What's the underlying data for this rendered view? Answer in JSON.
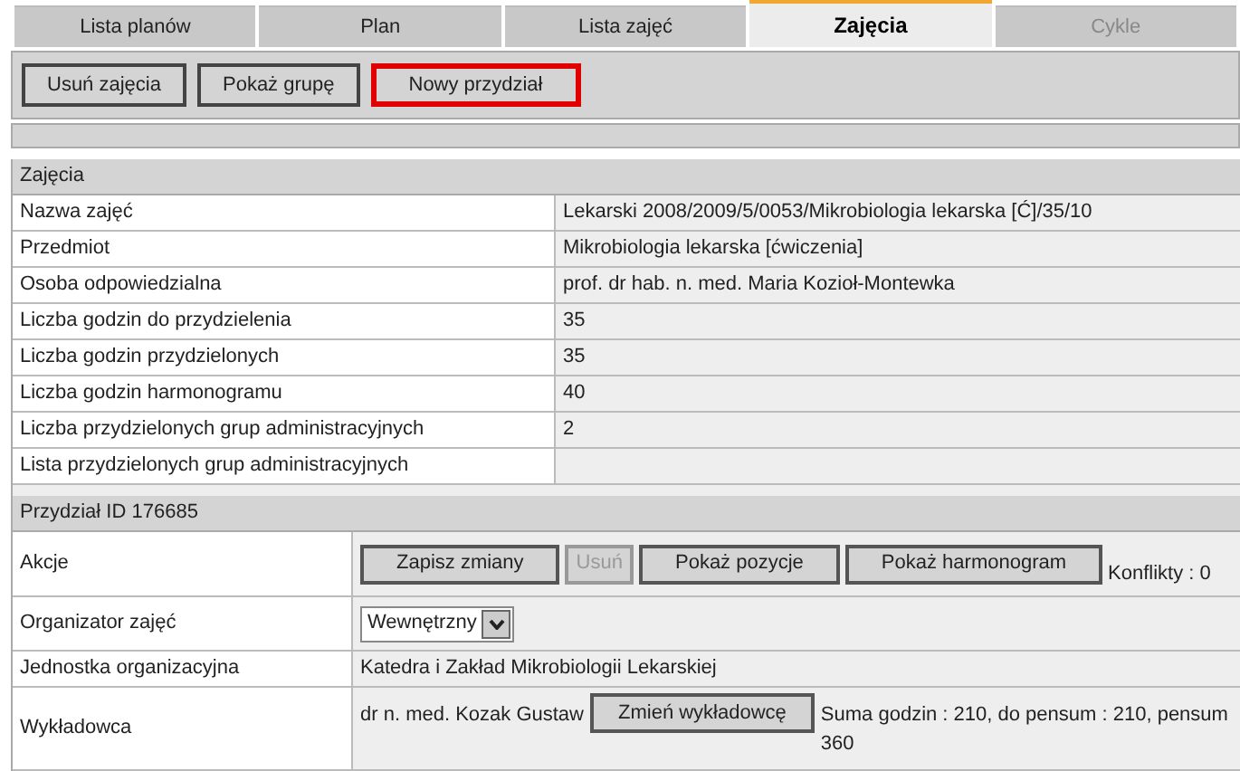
{
  "tabs": [
    {
      "label": "Lista planów",
      "selected": false,
      "disabled": false
    },
    {
      "label": "Plan",
      "selected": false,
      "disabled": false
    },
    {
      "label": "Lista zajęć",
      "selected": false,
      "disabled": false
    },
    {
      "label": "Zajęcia",
      "selected": true,
      "disabled": false
    },
    {
      "label": "Cykle",
      "selected": false,
      "disabled": true
    }
  ],
  "toolbar": [
    {
      "label": "Usuń zajęcia",
      "highlighted": false
    },
    {
      "label": "Pokaż grupę",
      "highlighted": false
    },
    {
      "label": "Nowy przydział",
      "highlighted": true
    }
  ],
  "zajecia": {
    "title": "Zajęcia",
    "rows": [
      {
        "label": "Nazwa zajęć",
        "value": "Lekarski 2008/2009/5/0053/Mikrobiologia lekarska [Ć]/35/10"
      },
      {
        "label": "Przedmiot",
        "value": "Mikrobiologia lekarska [ćwiczenia]"
      },
      {
        "label": "Osoba odpowiedzialna",
        "value": "prof. dr hab. n. med. Maria Kozioł-Montewka"
      },
      {
        "label": "Liczba godzin do przydzielenia",
        "value": "35"
      },
      {
        "label": "Liczba godzin przydzielonych",
        "value": "35"
      },
      {
        "label": "Liczba godzin harmonogramu",
        "value": "40"
      },
      {
        "label": "Liczba przydzielonych grup administracyjnych",
        "value": "2"
      },
      {
        "label": "Lista przydzielonych grup administracyjnych"
      }
    ]
  },
  "przydzial": {
    "title": "Przydział ID 176685",
    "akcje": {
      "label": "Akcje",
      "buttons": [
        {
          "label": "Zapisz zmiany",
          "disabled": false
        },
        {
          "label": "Usuń",
          "disabled": true
        },
        {
          "label": "Pokaż pozycje",
          "disabled": false
        },
        {
          "label": "Pokaż harmonogram",
          "disabled": false
        }
      ],
      "conflicts": "Konflikty : 0"
    },
    "organizator": {
      "label": "Organizator zajęć",
      "value": "Wewnętrzny"
    },
    "jednostka": {
      "label": "Jednostka organizacyjna",
      "value": "Katedra i Zakład Mikrobiologii Lekarskiej"
    },
    "wykladowca": {
      "label": "Wykładowca",
      "name": "dr n. med. Kozak Gustaw",
      "button": "Zmień wykładowcę",
      "summary": "Suma godzin : 210, do pensum : 210, pensum 360"
    }
  }
}
